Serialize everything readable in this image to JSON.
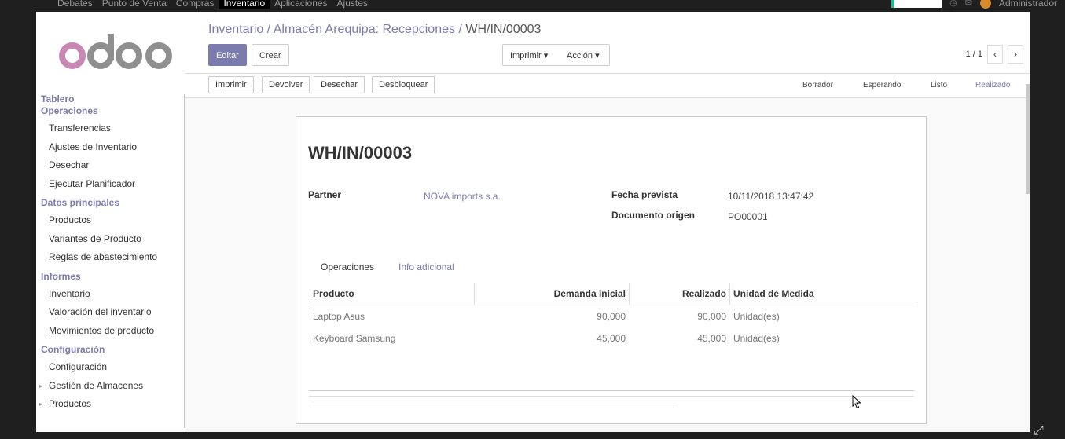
{
  "topbar": {
    "menu": [
      "Debates",
      "Punto de Venta",
      "Compras",
      "Inventario",
      "Aplicaciones",
      "Ajustes"
    ],
    "active_menu": "Inventario",
    "user": "Administrador"
  },
  "sidebar": {
    "logo_text": "odoo",
    "sections": [
      {
        "title": "Tablero",
        "items": []
      },
      {
        "title": "Operaciones",
        "items": [
          "Transferencias",
          "Ajustes de Inventario",
          "Desechar",
          "Ejecutar Planificador"
        ]
      },
      {
        "title": "Datos principales",
        "items": [
          "Productos",
          "Variantes de Producto",
          "Reglas de abastecimiento"
        ]
      },
      {
        "title": "Informes",
        "items": [
          "Inventario",
          "Valoración del inventario",
          "Movimientos de producto"
        ]
      },
      {
        "title": "Configuración",
        "items": [
          "Configuración",
          "Gestión de Almacenes",
          "Productos"
        ]
      }
    ]
  },
  "breadcrumb": {
    "parts": [
      "Inventario",
      "Almacén Arequipa: Recepciones"
    ],
    "current": "WH/IN/00003",
    "sep": "/"
  },
  "buttons": {
    "edit": "Editar",
    "create": "Crear",
    "print": "Imprimir",
    "action": "Acción"
  },
  "pager": {
    "value": "1 / 1"
  },
  "header": {
    "actions": [
      "Imprimir",
      "Devolver",
      "Desechar",
      "Desbloquear"
    ],
    "statuses": [
      "Borrador",
      "Esperando",
      "Listo",
      "Realizado"
    ],
    "current_status": "Realizado"
  },
  "record": {
    "name": "WH/IN/00003",
    "partner_label": "Partner",
    "partner": "NOVA imports s.a.",
    "date_label": "Fecha prevista",
    "date": "10/11/2018 13:47:42",
    "origin_label": "Documento origen",
    "origin": "PO00001"
  },
  "tabs": [
    "Operaciones",
    "Info adicional"
  ],
  "table": {
    "headers": [
      "Producto",
      "Demanda inicial",
      "Realizado",
      "Unidad de Medida"
    ],
    "rows": [
      [
        "Laptop Asus",
        "90,000",
        "90,000",
        "Unidad(es)"
      ],
      [
        "Keyboard Samsung",
        "45,000",
        "45,000",
        "Unidad(es)"
      ]
    ]
  },
  "colors": {
    "brand": "#7c7bad",
    "logo_pink": "#c987b3",
    "logo_gray": "#8f8f8f"
  }
}
